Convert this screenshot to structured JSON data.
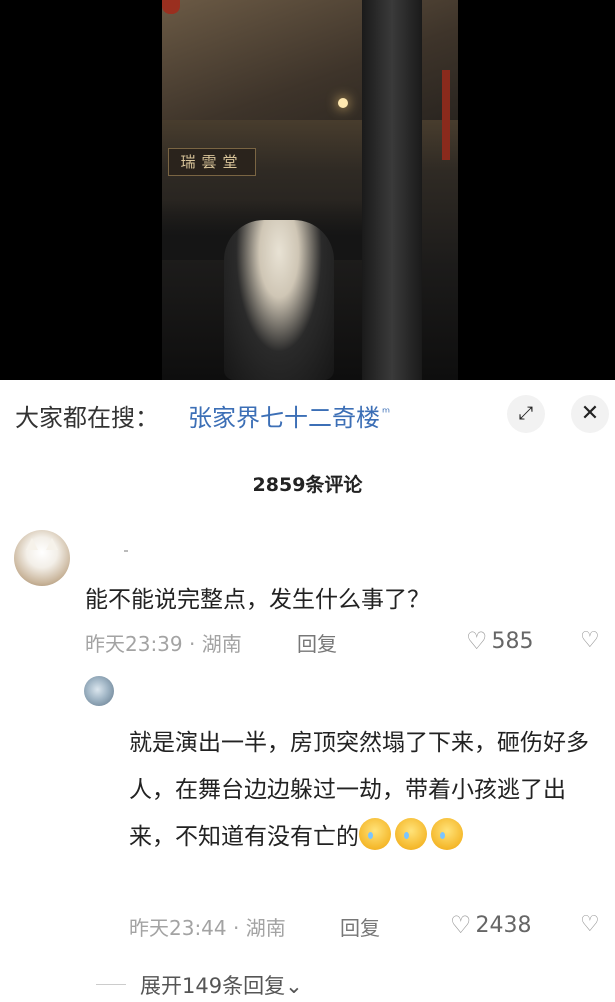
{
  "search": {
    "prefix": "大家都在搜：",
    "term": "张家界七十二奇楼",
    "search_glyph": "ᵠ"
  },
  "video": {
    "sign_text": "瑞雲堂"
  },
  "controls": {
    "expand_icon": "expand-icon",
    "expand_glyph": "⤢",
    "close_icon": "close-icon",
    "close_glyph": "✕"
  },
  "comments_header": {
    "count_label": "2859条评论"
  },
  "comments": [
    {
      "text": "能不能说完整点，发生什么事了？",
      "time_location": "昨天23:39 · 湖南",
      "reply_label": "回复",
      "likes": "585"
    }
  ],
  "reply": {
    "text": "就是演出一半，房顶突然塌了下来，砸伤好多人，在舞台边边躲过一劫，带着小孩逃了出来，不知道有没有亡的",
    "time_location": "昨天23:44 · 湖南",
    "reply_label": "回复",
    "likes": "2438"
  },
  "more_replies": {
    "label": "展开149条回复",
    "chevron": "⌄"
  },
  "colors": {
    "accent_link": "#3c6fb6",
    "meta_gray": "#a3a3a3"
  }
}
